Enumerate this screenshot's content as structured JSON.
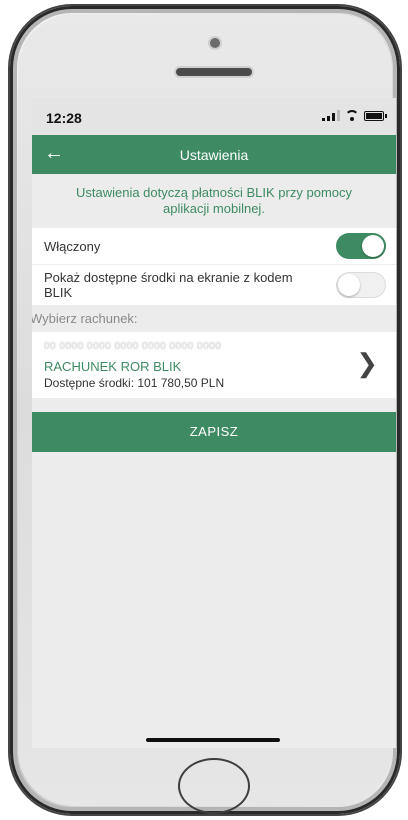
{
  "status_bar": {
    "time": "12:28"
  },
  "header": {
    "title": "Ustawienia"
  },
  "info_text": "Ustawienia dotyczą płatności BLIK przy pomocy aplikacji mobilnej.",
  "settings": {
    "enabled_label": "Włączony",
    "enabled_state": true,
    "show_funds_label": "Pokaż dostępne środki na ekranie z kodem BLIK",
    "show_funds_state": false
  },
  "account_section": {
    "label": "Wybierz rachunek:",
    "account_number": "00 0000 0000 0000 0000 0000 0000",
    "account_name": "RACHUNEK ROR BLIK",
    "available_funds": "Dostępne środki: 101 780,50 PLN"
  },
  "save_label": "ZAPISZ",
  "colors": {
    "accent": "#3e8b63",
    "background": "#ececec"
  },
  "icons": {
    "back": "arrow-left-icon",
    "chevron": "chevron-right-icon"
  }
}
